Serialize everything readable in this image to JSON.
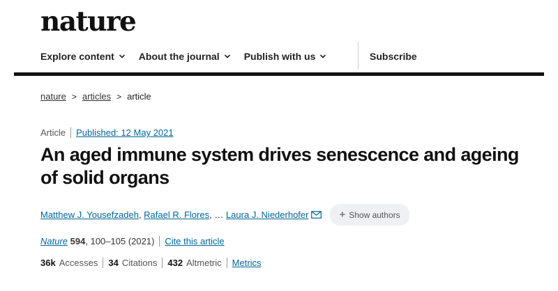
{
  "brand": {
    "logo": "nature"
  },
  "nav": {
    "items": [
      {
        "label": "Explore content"
      },
      {
        "label": "About the journal"
      },
      {
        "label": "Publish with us"
      }
    ],
    "subscribe": "Subscribe"
  },
  "breadcrumb": {
    "items": [
      "nature",
      "articles"
    ],
    "current": "article"
  },
  "article": {
    "type": "Article",
    "published": "Published: 12 May 2021",
    "title": "An aged immune system drives senescence and ageing of solid organs",
    "authors": [
      "Matthew J. Yousefzadeh",
      "Rafael R. Flores",
      "Laura J. Niederhofer"
    ],
    "ellipsis": "…",
    "show_authors": "Show authors"
  },
  "citation": {
    "journal": "Nature",
    "volume": "594",
    "pages": "100–105 (2021)",
    "cite_link": "Cite this article"
  },
  "metrics": {
    "accesses_value": "36k",
    "accesses_label": "Accesses",
    "citations_value": "34",
    "citations_label": "Citations",
    "altmetric_value": "432",
    "altmetric_label": "Altmetric",
    "metrics_link": "Metrics"
  },
  "colors": {
    "link": "#006699",
    "rule": "#111111",
    "chip_bg": "#eef0f3"
  }
}
